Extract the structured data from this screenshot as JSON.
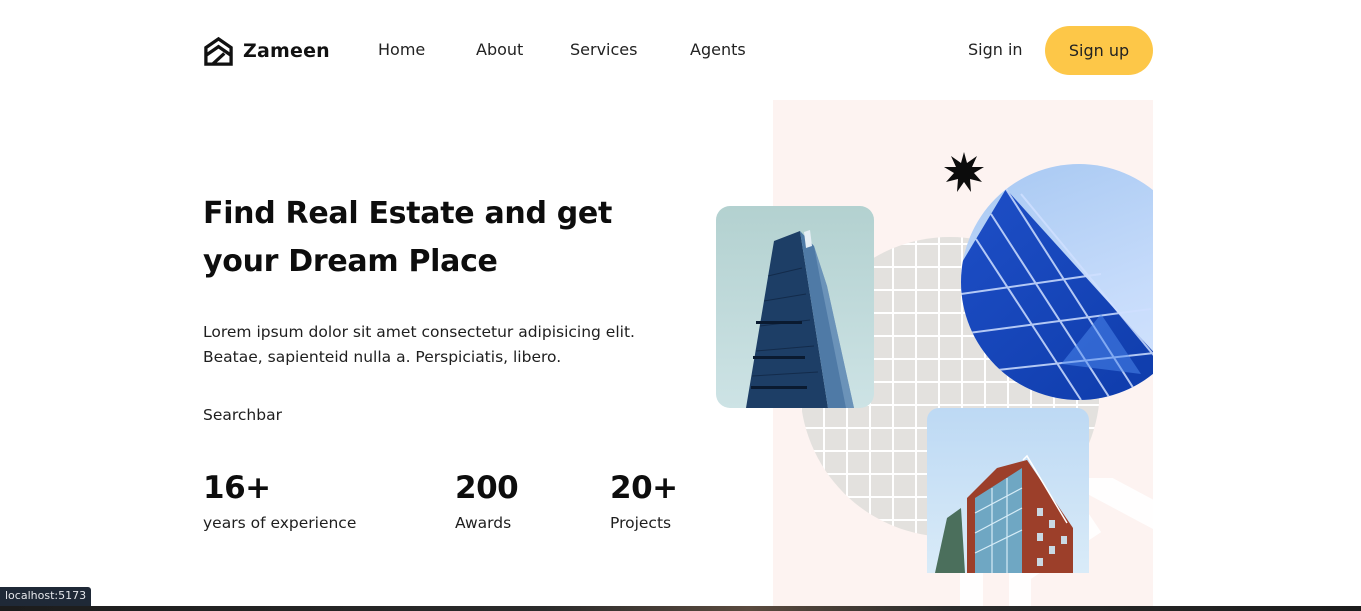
{
  "nav": {
    "brand": "Zameen",
    "links": [
      "Home",
      "About",
      "Services",
      "Agents"
    ],
    "sign_in": "Sign in",
    "sign_up": "Sign up",
    "accent_color": "#fdc748"
  },
  "hero": {
    "title_line1": "Find Real Estate and get",
    "title_line2": "your Dream Place",
    "desc_line1": "Lorem ipsum dolor sit amet consectetur adipisicing elit.",
    "desc_line2": "Beatae, sapienteid nulla a. Perspiciatis, libero.",
    "searchbar": "Searchbar",
    "stats": [
      {
        "value": "16+",
        "label": "years of experience"
      },
      {
        "value": "200",
        "label": "Awards"
      },
      {
        "value": "20+",
        "label": "Projects"
      }
    ]
  },
  "images": {
    "img1": "skyscraper-photo",
    "img2": "glass-building-photo",
    "img3": "brick-building-photo"
  },
  "status": {
    "url": "localhost:5173"
  }
}
